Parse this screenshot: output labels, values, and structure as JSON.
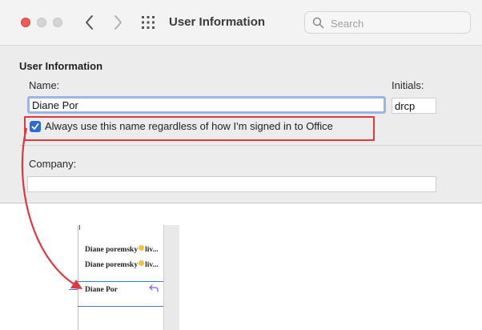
{
  "window": {
    "title": "User Information",
    "search": {
      "placeholder": "Search"
    }
  },
  "form": {
    "section_title": "User Information",
    "name_label": "Name:",
    "name_value": "Diane Por",
    "initials_label": "Initials:",
    "initials_value": "drcp",
    "checkbox": {
      "checked": true,
      "label": "Always use this name regardless of how I'm signed in to Office"
    },
    "company_label": "Company:",
    "company_value": ""
  },
  "document": {
    "entries": [
      {
        "author": "Diane poremsky",
        "suffix": "liv..."
      },
      {
        "author": "Diane poremsky",
        "suffix": "liv..."
      }
    ],
    "current_author": "Diane Por"
  },
  "colors": {
    "highlight_border": "#e0383e",
    "annotation_arrow": "#e0383e",
    "checkbox_fill": "#2a6cd6",
    "focus_ring": "#9ab6e4"
  },
  "icons": {
    "back": "chevron-left-icon",
    "forward": "chevron-right-icon",
    "grid": "grid-icon",
    "search": "search-icon",
    "reply": "reply-icon"
  }
}
